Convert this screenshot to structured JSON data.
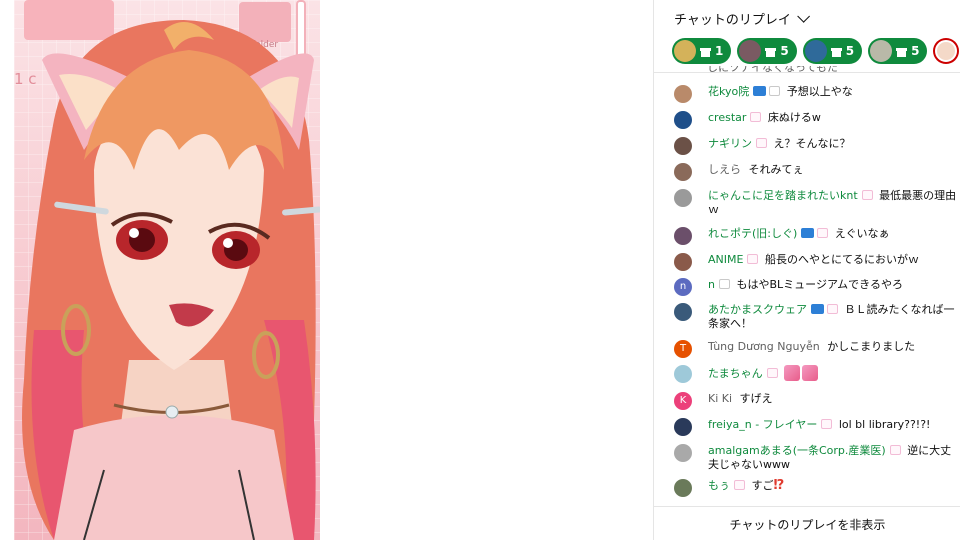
{
  "video": {
    "folder_label": "folder",
    "side_text": "1 c"
  },
  "chat": {
    "header_title": "チャットのリプレイ",
    "tickers": [
      {
        "count": "1",
        "color": "#d4b25a"
      },
      {
        "count": "5",
        "color": "#7a5a62"
      },
      {
        "count": "5",
        "color": "#2f6a9a"
      },
      {
        "count": "5",
        "color": "#b9b9a8"
      }
    ],
    "cut_text": "しにツナイなくなってもた",
    "messages": [
      {
        "author": "花kyo院",
        "text": "予想以上やな",
        "avatar": "#b98a6a",
        "membership": true
      },
      {
        "author": "crestar",
        "text": "床ぬけるw",
        "avatar": "#1f4f8a",
        "membership": false
      },
      {
        "author": "ナギリン",
        "text": "え？そんなに？",
        "avatar": "#6b5147",
        "membership": false
      },
      {
        "author": "しえら",
        "text": "それみてぇ",
        "avatar": "#8a6a5a",
        "membership": false
      },
      {
        "author": "にゃんこに足を踏まれたいknt",
        "text": "最低最悪の理由ｗ",
        "avatar": "#9a9a9a",
        "membership": false
      },
      {
        "author": "れこポテ(旧:しぐ)",
        "text": "えぐいなぁ",
        "avatar": "#6b4f6a",
        "membership": true
      },
      {
        "author": "ANIME",
        "text": "船長のへやとにてるにおいがｗ",
        "avatar": "#8a5a4a",
        "membership": false
      },
      {
        "author": "n",
        "text": "もはやBLミュージアムできるやろ",
        "avatar": "#5c6bc0",
        "initial": "n",
        "membership": false
      },
      {
        "author": "あたかまスクウェア",
        "text": "ＢＬ読みたくなれば一条家へ！",
        "avatar": "#3a5a7a",
        "membership": true
      },
      {
        "author": "Tùng Dương Nguyễn",
        "text": "かしこまりました",
        "avatar": "#e65100",
        "initial": "T",
        "membership": false
      },
      {
        "author": "たまちゃん",
        "text": "",
        "avatar": "#9ec9d9",
        "membership": false
      },
      {
        "author": "Ki Ki",
        "text": "すげえ",
        "avatar": "#ec407a",
        "initial": "K",
        "membership": false
      },
      {
        "author": "freiya_n - フレイヤー",
        "text": "lol bl library??!?!",
        "avatar": "#2a3a5a",
        "membership": false
      },
      {
        "author": "amalgamあまる(一条Corp.産業医)",
        "text": "逆に大丈夫じゃないwww",
        "avatar": "#a9a9a9",
        "membership": false
      },
      {
        "author": "もぅ",
        "text": "すご",
        "avatar": "#6a7a5a",
        "membership": false
      }
    ],
    "footer_label": "チャットのリプレイを非表示"
  }
}
